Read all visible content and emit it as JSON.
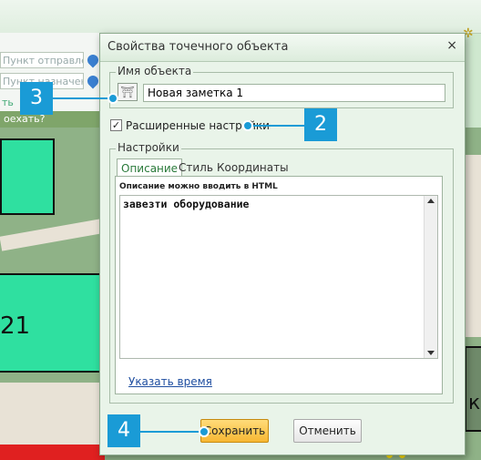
{
  "background": {
    "from_placeholder": "Пункт отправления",
    "to_placeholder": "Пункт назначения",
    "partial_link": "ть",
    "partial_question": "оехать?",
    "map_label": "21",
    "right_edge_glyph": "к"
  },
  "dialog": {
    "title": "Свойства точечного объекта",
    "close_glyph": "×",
    "name_group": {
      "legend": "Имя объекта",
      "value": "Новая заметка 1"
    },
    "advanced": {
      "label": "Расширенные настройки",
      "checked": true
    },
    "settings": {
      "legend": "Настройки",
      "tabs": [
        {
          "label": "Описание",
          "active": true
        },
        {
          "label": "Стиль",
          "active": false
        },
        {
          "label": "Координаты",
          "active": false
        }
      ],
      "hint": "Описание можно вводить в HTML",
      "description": "завезти оборудование",
      "time_link": "Указать время"
    },
    "buttons": {
      "save": "Сохранить",
      "cancel": "Отменить"
    }
  },
  "callouts": [
    {
      "label": "3",
      "target": "object-icon"
    },
    {
      "label": "2",
      "target": "advanced-settings-checkbox"
    },
    {
      "label": "4",
      "target": "save-button"
    }
  ],
  "colors": {
    "accent": "#1a9bd6",
    "save_button": "#f7b733",
    "building": "#2fe0a0"
  }
}
